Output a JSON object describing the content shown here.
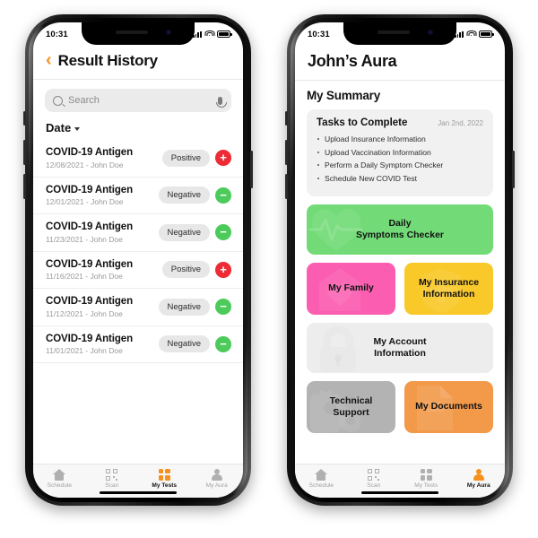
{
  "phones": {
    "left": {
      "status": {
        "time": "10:31",
        "signal_icon": "cellular-signal-icon",
        "wifi_icon": "wifi-icon",
        "battery_icon": "battery-icon"
      },
      "header": {
        "back_icon": "back-chevron-icon",
        "title": "Result History"
      },
      "search": {
        "placeholder": "Search",
        "icon": "search-icon",
        "mic_icon": "microphone-icon"
      },
      "sort": {
        "label": "Date",
        "caret_icon": "chevron-down-icon"
      },
      "results": [
        {
          "name": "COVID-19 Antigen",
          "sub": "12/08/2021 - John Doe",
          "status": "Positive",
          "badge": "plus-icon",
          "type": "pos"
        },
        {
          "name": "COVID-19 Antigen",
          "sub": "12/01/2021 - John Doe",
          "status": "Negative",
          "badge": "minus-icon",
          "type": "neg"
        },
        {
          "name": "COVID-19 Antigen",
          "sub": "11/23/2021 - John Doe",
          "status": "Negative",
          "badge": "minus-icon",
          "type": "neg"
        },
        {
          "name": "COVID-19 Antigen",
          "sub": "11/16/2021 - John Doe",
          "status": "Positive",
          "badge": "plus-icon",
          "type": "pos"
        },
        {
          "name": "COVID-19 Antigen",
          "sub": "11/12/2021 - John Doe",
          "status": "Negative",
          "badge": "minus-icon",
          "type": "neg"
        },
        {
          "name": "COVID-19 Antigen",
          "sub": "11/01/2021 - John Doe",
          "status": "Negative",
          "badge": "minus-icon",
          "type": "neg"
        }
      ],
      "tabs": [
        {
          "label": "Schedule",
          "icon": "home-icon",
          "active": false
        },
        {
          "label": "Scan",
          "icon": "qr-code-icon",
          "active": false
        },
        {
          "label": "My Tests",
          "icon": "grid-icon",
          "active": true
        },
        {
          "label": "My Aura",
          "icon": "person-icon",
          "active": false
        }
      ]
    },
    "right": {
      "status": {
        "time": "10:31",
        "signal_icon": "cellular-signal-icon",
        "wifi_icon": "wifi-icon",
        "battery_icon": "battery-icon"
      },
      "header": {
        "title": "John’s Aura"
      },
      "section_title": "My Summary",
      "tasks_card": {
        "title": "Tasks to Complete",
        "date": "Jan 2nd, 2022",
        "items": [
          "Upload Insurance Information",
          "Upload Vaccination Information",
          "Perform a Daily Symptom Checker",
          "Schedule New COVID Test"
        ]
      },
      "tiles": [
        {
          "label": "Daily\nSymptoms Checker",
          "line1": "Daily",
          "line2": "Symptoms Checker",
          "color": "#72DB77",
          "icon": "heartbeat-icon"
        },
        {
          "label": "My Family",
          "line1": "My Family",
          "line2": "",
          "color": "#FB5EB1",
          "icon": "house-icon"
        },
        {
          "label": "My Insurance Information",
          "line1": "My Insurance",
          "line2": "Information",
          "color": "#F9C92A",
          "icon": "shield-cross-icon"
        },
        {
          "label": "My Account Information",
          "line1": "My Account",
          "line2": "Information",
          "color": "#ededed",
          "icon": "lock-icon"
        },
        {
          "label": "Technical Support",
          "line1": "Technical",
          "line2": "Support",
          "color": "#b3b3b3",
          "icon": "gears-icon"
        },
        {
          "label": "My Documents",
          "line1": "My Documents",
          "line2": "",
          "color": "#F2994A",
          "icon": "document-icon"
        }
      ],
      "tabs": [
        {
          "label": "Schedule",
          "icon": "home-icon",
          "active": false
        },
        {
          "label": "Scan",
          "icon": "qr-code-icon",
          "active": false
        },
        {
          "label": "My Tests",
          "icon": "grid-icon",
          "active": false
        },
        {
          "label": "My Aura",
          "icon": "person-icon",
          "active": true
        }
      ]
    }
  },
  "colors": {
    "accent_orange": "#F7901E",
    "positive_red": "#EE2B34",
    "negative_green": "#4CCB5B"
  }
}
